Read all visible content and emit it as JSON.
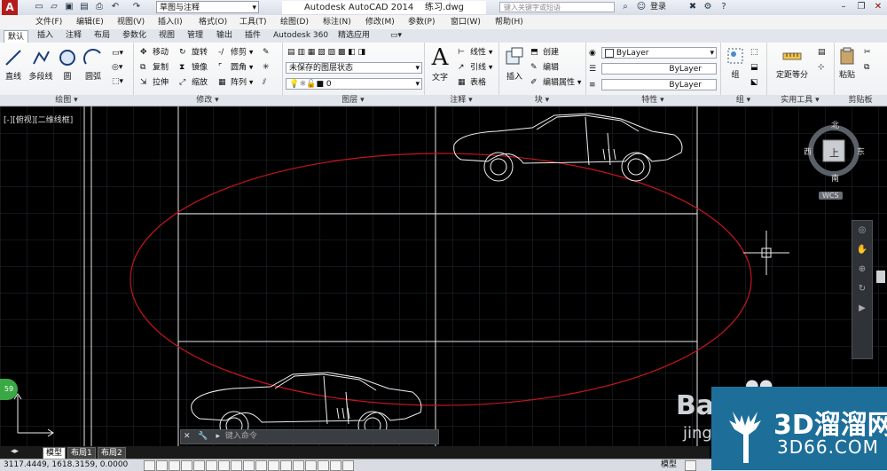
{
  "app": {
    "logo_letter": "A",
    "workspace": "草图与注释",
    "title": "Autodesk AutoCAD 2014",
    "filename": "练习.dwg",
    "search_placeholder": "键入关键字或短语",
    "login": "登录"
  },
  "menu": [
    "文件(F)",
    "编辑(E)",
    "视图(V)",
    "插入(I)",
    "格式(O)",
    "工具(T)",
    "绘图(D)",
    "标注(N)",
    "修改(M)",
    "参数(P)",
    "窗口(W)",
    "帮助(H)"
  ],
  "ribbon_tabs": [
    "默认",
    "插入",
    "注释",
    "布局",
    "参数化",
    "视图",
    "管理",
    "输出",
    "插件",
    "Autodesk 360",
    "精选应用"
  ],
  "draw": {
    "label": "绘图",
    "line": "直线",
    "polyline": "多段线",
    "circle": "圆",
    "arc": "圆弧"
  },
  "modify": {
    "label": "修改",
    "move": "移动",
    "rotate": "旋转",
    "trim": "修剪",
    "copy": "复制",
    "mirror": "镜像",
    "fillet": "圆角",
    "stretch": "拉伸",
    "scale": "缩放",
    "array": "阵列"
  },
  "layers": {
    "label": "图层",
    "state": "未保存的图层状态",
    "current": "0"
  },
  "annotation": {
    "label": "注释",
    "text": "文字",
    "linear": "线性",
    "leader": "引线",
    "table": "表格"
  },
  "block": {
    "label": "块",
    "insert": "插入",
    "create": "创建",
    "edit": "编辑",
    "edit_attr": "编辑属性"
  },
  "properties": {
    "label": "特性",
    "color": "ByLayer",
    "linetype": "ByLayer",
    "lineweight": "ByLayer"
  },
  "groups": {
    "label": "组",
    "group": "组"
  },
  "utilities": {
    "label": "实用工具",
    "measure": "定距等分"
  },
  "clipboard": {
    "label": "剪贴板",
    "paste": "粘贴"
  },
  "viewport": {
    "label": "[-][俯视][二维线框]",
    "compass": {
      "n": "北",
      "s": "南",
      "e": "东",
      "w": "西",
      "top": "上"
    },
    "wcs": "WCS",
    "cmd_placeholder": "键入命令"
  },
  "layout_tabs": [
    "模型",
    "布局1",
    "布局2"
  ],
  "status": {
    "coords": "3117.4449, 1618.3159, 0.0000",
    "model": "模型"
  },
  "watermark": {
    "text": "3D溜溜网",
    "url": "3D66.COM",
    "baidu": "Bai",
    "jing": "jing"
  },
  "badge": "59",
  "colors": {
    "ellipse": "#c8141e",
    "logo": "#b41c1c",
    "accent": "#1d6f9a"
  }
}
